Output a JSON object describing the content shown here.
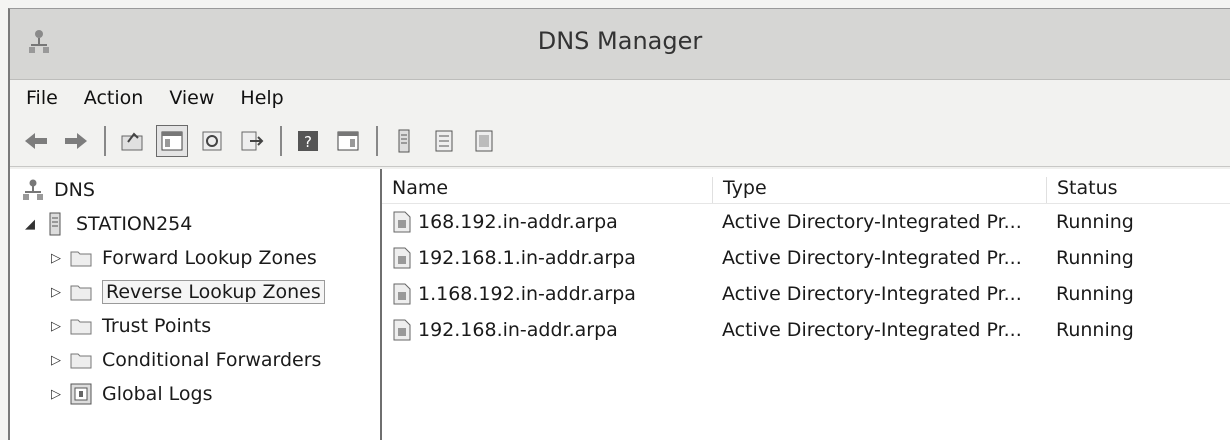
{
  "window": {
    "title": "DNS Manager"
  },
  "menu": [
    "File",
    "Action",
    "View",
    "Help"
  ],
  "toolbar": {
    "icons": [
      "back-arrow-icon",
      "forward-arrow-icon",
      "up-folder-icon",
      "show-hide-console-tree-icon",
      "refresh-icon",
      "export-list-icon",
      "help-icon",
      "show-hide-action-pane-icon",
      "server-icon",
      "list-icon",
      "properties-icon"
    ]
  },
  "tree": {
    "root": "DNS",
    "server": "STATION254",
    "children": [
      "Forward Lookup Zones",
      "Reverse Lookup Zones",
      "Trust Points",
      "Conditional Forwarders",
      "Global Logs"
    ],
    "selected": "Reverse Lookup Zones"
  },
  "list": {
    "headers": {
      "name": "Name",
      "type": "Type",
      "status": "Status"
    },
    "rows": [
      {
        "name": "168.192.in-addr.arpa",
        "type": "Active Directory-Integrated Pr...",
        "status": "Running"
      },
      {
        "name": "192.168.1.in-addr.arpa",
        "type": "Active Directory-Integrated Pr...",
        "status": "Running"
      },
      {
        "name": "1.168.192.in-addr.arpa",
        "type": "Active Directory-Integrated Pr...",
        "status": "Running"
      },
      {
        "name": "192.168.in-addr.arpa",
        "type": "Active Directory-Integrated Pr...",
        "status": "Running"
      }
    ]
  }
}
